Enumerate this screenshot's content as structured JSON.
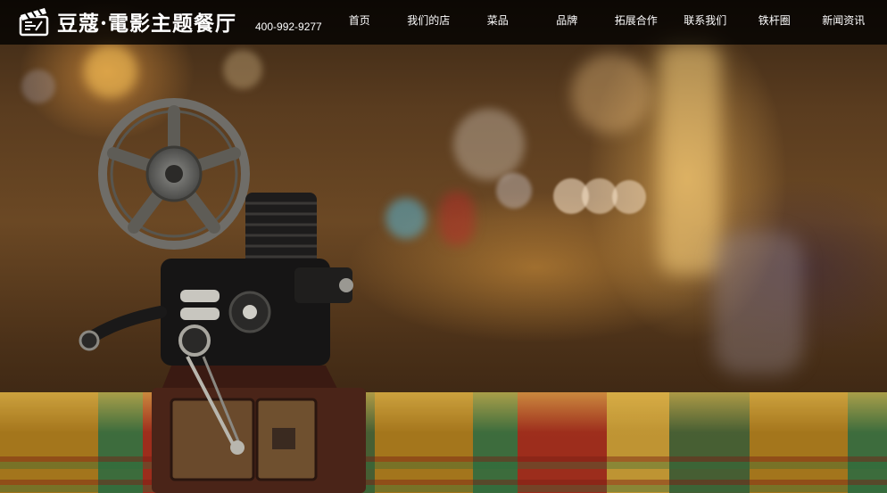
{
  "header": {
    "brand_name": "豆蔻·電影主题餐厅",
    "phone": "400-992-9277"
  },
  "nav": {
    "items": [
      {
        "label": "首页"
      },
      {
        "label": "我们的店"
      },
      {
        "label": "菜品"
      },
      {
        "label": "品牌"
      },
      {
        "label": "拓展合作"
      },
      {
        "label": "联系我们"
      },
      {
        "label": "铁杆圈"
      },
      {
        "label": "新闻资讯"
      }
    ]
  },
  "hero": {
    "image": "vintage-film-projector-on-restaurant-table",
    "colors": {
      "nav_bg": "#000000",
      "nav_text": "#ffffff",
      "warm_glow": "#ffc460"
    }
  }
}
